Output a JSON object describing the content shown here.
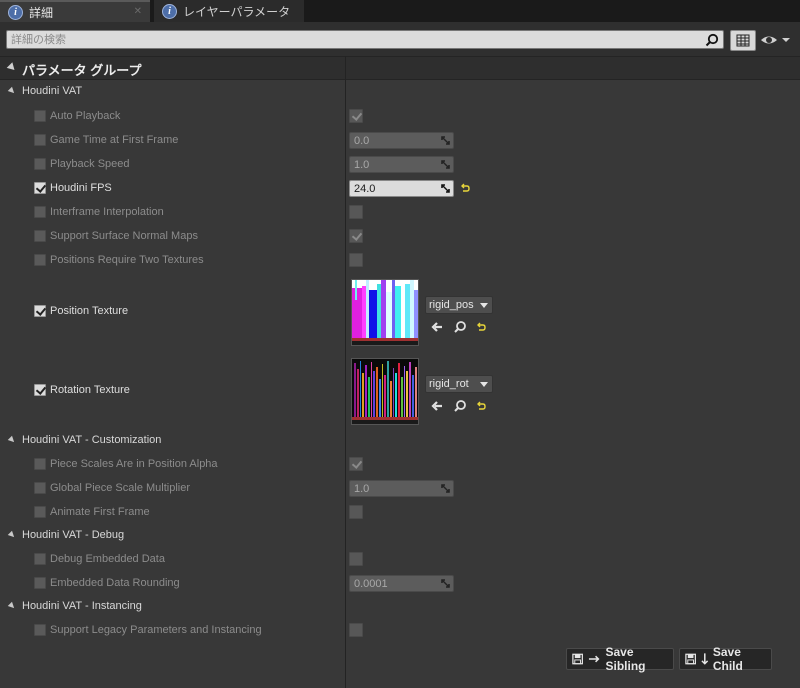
{
  "tabs": [
    {
      "label": "詳細"
    },
    {
      "label": "レイヤーパラメータ"
    }
  ],
  "search": {
    "placeholder": "詳細の検索"
  },
  "header": {
    "title": "パラメータ グループ"
  },
  "categories": [
    {
      "label": "Houdini VAT"
    },
    {
      "label": "Houdini VAT - Customization"
    },
    {
      "label": "Houdini VAT - Debug"
    },
    {
      "label": "Houdini VAT - Instancing"
    }
  ],
  "params": {
    "auto_playback": {
      "label": "Auto Playback",
      "override": false,
      "value": true
    },
    "game_time": {
      "label": "Game Time at First Frame",
      "override": false,
      "value": "0.0"
    },
    "playback_speed": {
      "label": "Playback Speed",
      "override": false,
      "value": "1.0"
    },
    "houdini_fps": {
      "label": "Houdini FPS",
      "override": true,
      "value": "24.0"
    },
    "interframe": {
      "label": "Interframe Interpolation",
      "override": false,
      "value": false
    },
    "surface_normal": {
      "label": "Support Surface Normal Maps",
      "override": false,
      "value": true
    },
    "two_textures": {
      "label": "Positions Require Two Textures",
      "override": false,
      "value": false
    },
    "position_texture": {
      "label": "Position Texture",
      "override": true,
      "asset": "rigid_pos"
    },
    "rotation_texture": {
      "label": "Rotation Texture",
      "override": true,
      "asset": "rigid_rot"
    },
    "piece_scales": {
      "label": "Piece Scales Are in Position Alpha",
      "override": false,
      "value": true
    },
    "global_scale": {
      "label": "Global Piece Scale Multiplier",
      "override": false,
      "value": "1.0"
    },
    "animate_first": {
      "label": "Animate First Frame",
      "override": false,
      "value": false
    },
    "debug_embedded": {
      "label": "Debug Embedded Data",
      "override": false,
      "value": false
    },
    "embedded_rounding": {
      "label": "Embedded Data Rounding",
      "override": false,
      "value": "0.0001"
    },
    "legacy": {
      "label": "Support Legacy Parameters and Instancing",
      "override": false,
      "value": false
    }
  },
  "buttons": {
    "save_sibling": "Save Sibling",
    "save_child": "Save Child"
  },
  "icons": {
    "tab": "info-icon",
    "search": "search-icon",
    "view": "grid-icon",
    "visibility": "eye-icon",
    "reset": "reset-arrow-icon",
    "browse": "browse-arrow-icon",
    "find": "find-in-browser-icon"
  },
  "colors": {
    "reset_yellow": "#e8d63a",
    "panel": "#383838"
  }
}
